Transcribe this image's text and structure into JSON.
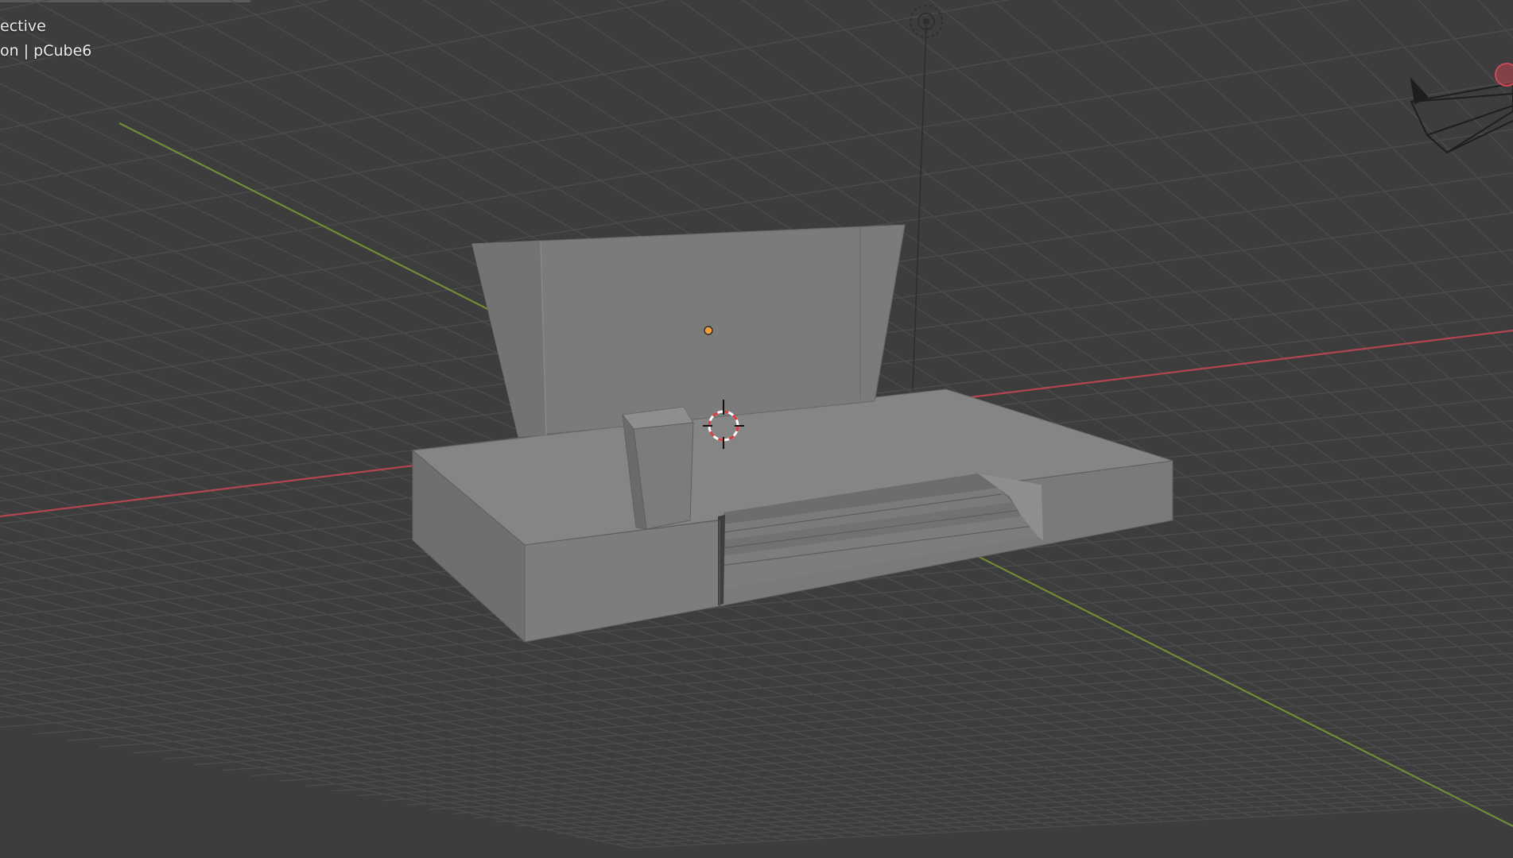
{
  "viewport": {
    "view_mode_label": "ective",
    "object_info_label": "on | pCube6"
  },
  "colors": {
    "background": "#3d3d3d",
    "grid_line": "#4a4a4a",
    "x_axis": "#c0454f",
    "y_axis": "#7a9a3a",
    "mesh_front": "#7b7b7b",
    "mesh_top": "#888888",
    "mesh_dark": "#6a6a6a",
    "origin_dot": "#f3a03c",
    "text": "#ececec"
  },
  "icons": {
    "light": "light-icon",
    "camera": "camera-icon",
    "cursor": "3d-cursor-icon",
    "origin": "object-origin-icon"
  }
}
